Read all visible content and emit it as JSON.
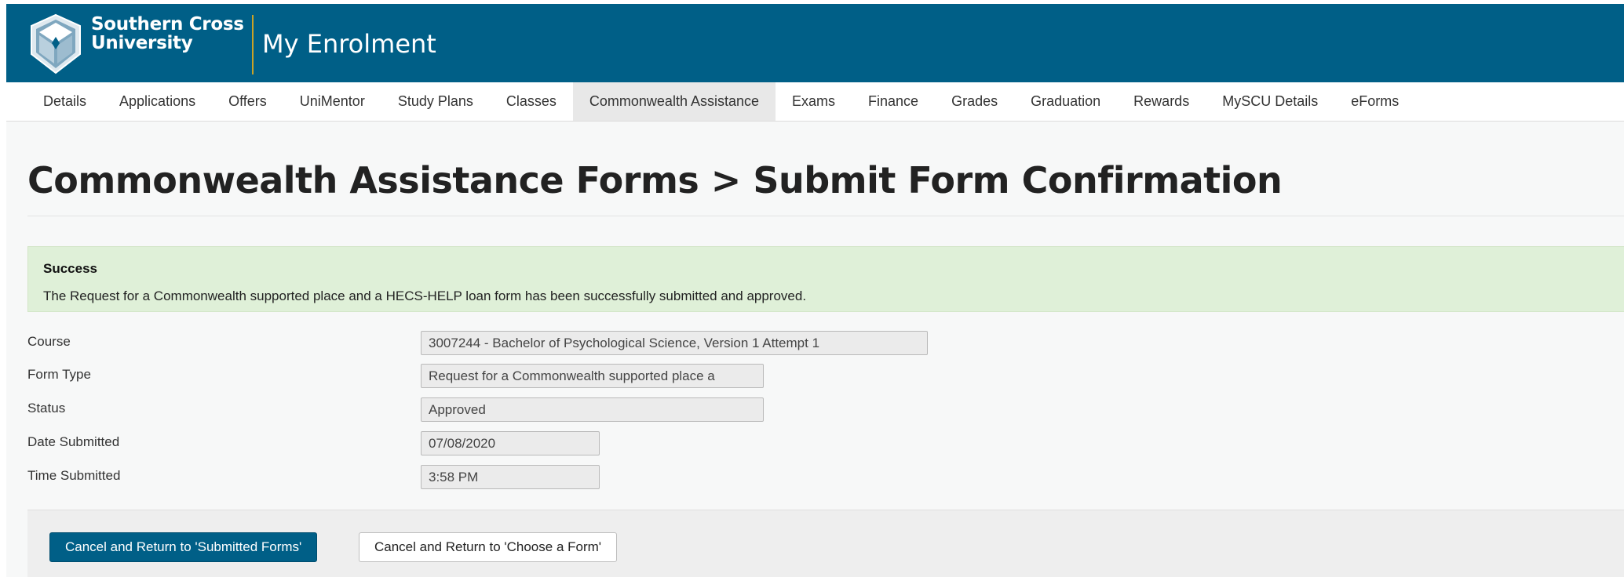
{
  "header": {
    "university_name_line1": "Southern Cross",
    "university_name_line2": "University",
    "app_title": "My Enrolment"
  },
  "nav": {
    "items": [
      {
        "label": "Details"
      },
      {
        "label": "Applications"
      },
      {
        "label": "Offers"
      },
      {
        "label": "UniMentor"
      },
      {
        "label": "Study Plans"
      },
      {
        "label": "Classes"
      },
      {
        "label": "Commonwealth Assistance",
        "active": true
      },
      {
        "label": "Exams"
      },
      {
        "label": "Finance"
      },
      {
        "label": "Grades"
      },
      {
        "label": "Graduation"
      },
      {
        "label": "Rewards"
      },
      {
        "label": "MySCU Details"
      },
      {
        "label": "eForms"
      }
    ]
  },
  "page": {
    "title": "Commonwealth Assistance Forms > Submit Form Confirmation"
  },
  "alert": {
    "title": "Success",
    "message": "The Request for a Commonwealth supported place and a HECS-HELP loan form has been successfully submitted and approved."
  },
  "form": {
    "course": {
      "label": "Course",
      "value": "3007244 - Bachelor of Psychological Science, Version 1 Attempt 1"
    },
    "form_type": {
      "label": "Form Type",
      "value": "Request for a Commonwealth supported place a"
    },
    "status": {
      "label": "Status",
      "value": "Approved"
    },
    "date_submitted": {
      "label": "Date Submitted",
      "value": "07/08/2020"
    },
    "time_submitted": {
      "label": "Time Submitted",
      "value": "3:58 PM"
    }
  },
  "actions": {
    "primary_label": "Cancel and Return to 'Submitted Forms'",
    "secondary_label": "Cancel and Return to 'Choose a Form'"
  },
  "colors": {
    "brand_blue": "#005f87",
    "accent_gold": "#c9a227",
    "success_bg": "#dff0d8"
  }
}
